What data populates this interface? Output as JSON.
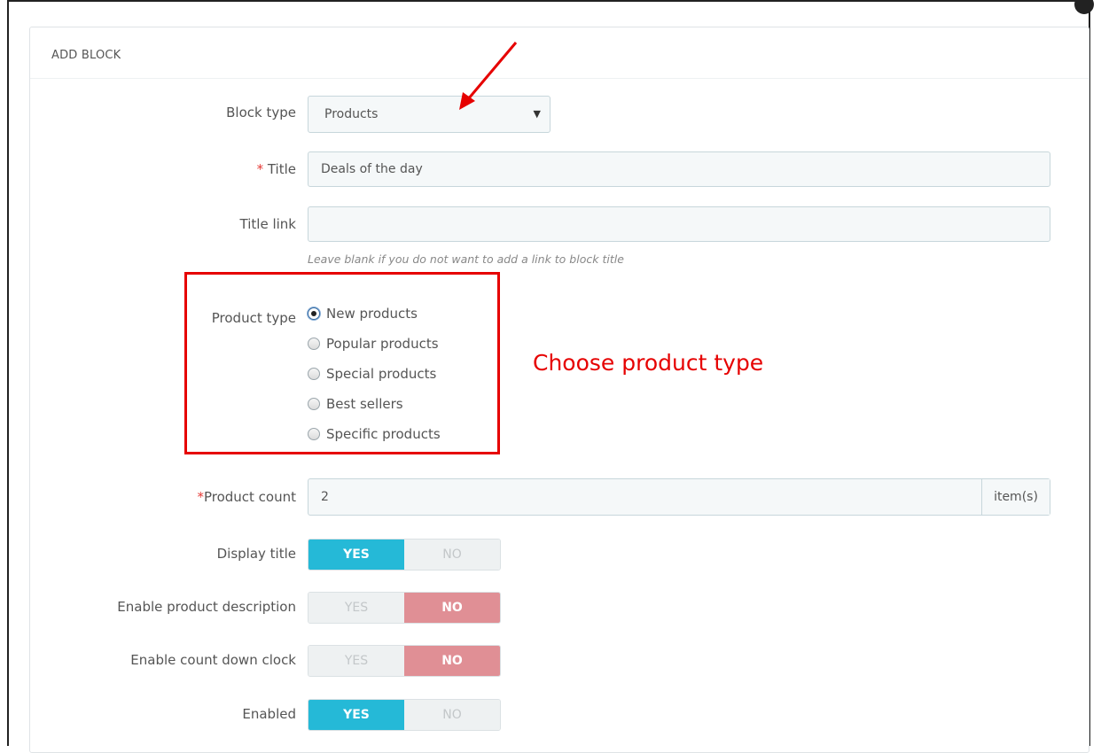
{
  "panel": {
    "heading": "ADD BLOCK"
  },
  "form": {
    "block_type": {
      "label": "Block type",
      "value": "Products"
    },
    "title": {
      "required_mark": "*",
      "label": " Title",
      "value": "Deals of the day"
    },
    "title_link": {
      "label": "Title link",
      "value": "",
      "help": "Leave blank if you do not want to add a link to block title"
    },
    "product_type": {
      "label": "Product type",
      "options": [
        {
          "label": "New products",
          "checked": true
        },
        {
          "label": "Popular products",
          "checked": false
        },
        {
          "label": "Special products",
          "checked": false
        },
        {
          "label": "Best sellers",
          "checked": false
        },
        {
          "label": "Specific products",
          "checked": false
        }
      ]
    },
    "product_count": {
      "required_mark": "*",
      "label": "Product count",
      "value": "2",
      "suffix": "item(s)"
    },
    "switches": [
      {
        "label": "Display title",
        "yes": "YES",
        "no": "NO",
        "value": "YES"
      },
      {
        "label": "Enable product description",
        "yes": "YES",
        "no": "NO",
        "value": "NO"
      },
      {
        "label": "Enable count down clock",
        "yes": "YES",
        "no": "NO",
        "value": "NO"
      },
      {
        "label": "Enabled",
        "yes": "YES",
        "no": "NO",
        "value": "YES"
      }
    ]
  },
  "annotation": {
    "text": "Choose product type",
    "color": "#e60000"
  },
  "colors": {
    "switch_yes": "#25b9d7",
    "switch_no": "#e08f95"
  }
}
